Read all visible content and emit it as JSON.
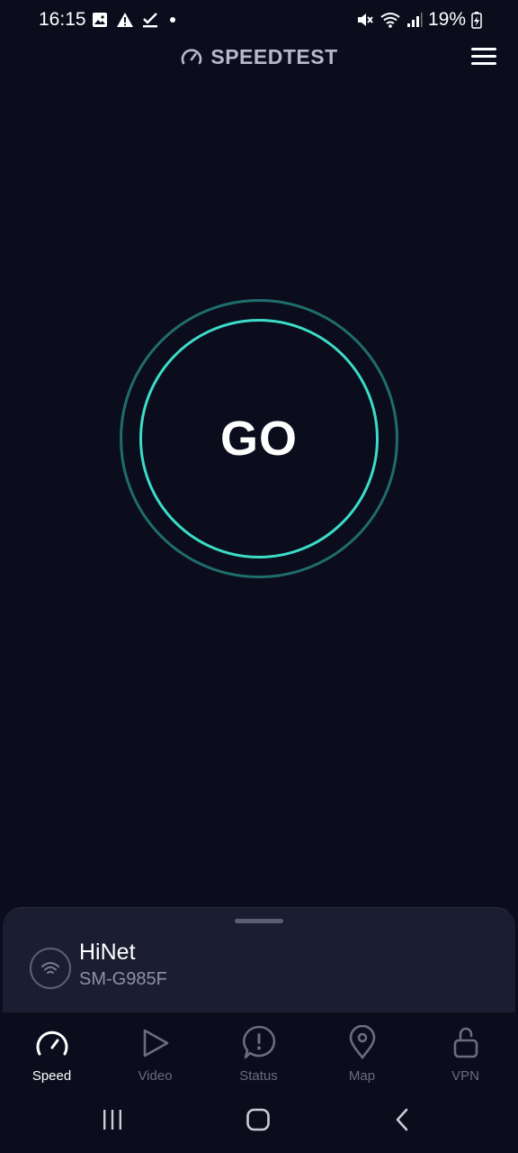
{
  "status_bar": {
    "time": "16:15",
    "battery": "19%",
    "left_icons": [
      "image-icon",
      "warning-icon",
      "check-download-icon",
      "dot-icon"
    ],
    "right_icons": [
      "mute-icon",
      "wifi-icon",
      "signal-icon",
      "battery-charging-icon"
    ]
  },
  "header": {
    "logo_text": "SPEEDTEST",
    "menu_icon": "hamburger-menu-icon"
  },
  "go_button": {
    "label": "GO",
    "accent": "#3cdcc8",
    "ring": "#1f6d6c"
  },
  "connection": {
    "name": "HiNet",
    "device": "SM-G985F",
    "icon": "wifi-icon"
  },
  "nav": {
    "items": [
      {
        "label": "Speed",
        "icon": "speedometer-icon",
        "active": true
      },
      {
        "label": "Video",
        "icon": "play-icon",
        "active": false
      },
      {
        "label": "Status",
        "icon": "alert-bubble-icon",
        "active": false
      },
      {
        "label": "Map",
        "icon": "map-pin-icon",
        "active": false
      },
      {
        "label": "VPN",
        "icon": "unlock-icon",
        "active": false
      }
    ]
  },
  "system_nav": [
    "recents-icon",
    "home-icon",
    "back-icon"
  ],
  "colors": {
    "background": "#0b0d1d",
    "card": "#1b1d31",
    "inactive": "#6a6d80"
  }
}
